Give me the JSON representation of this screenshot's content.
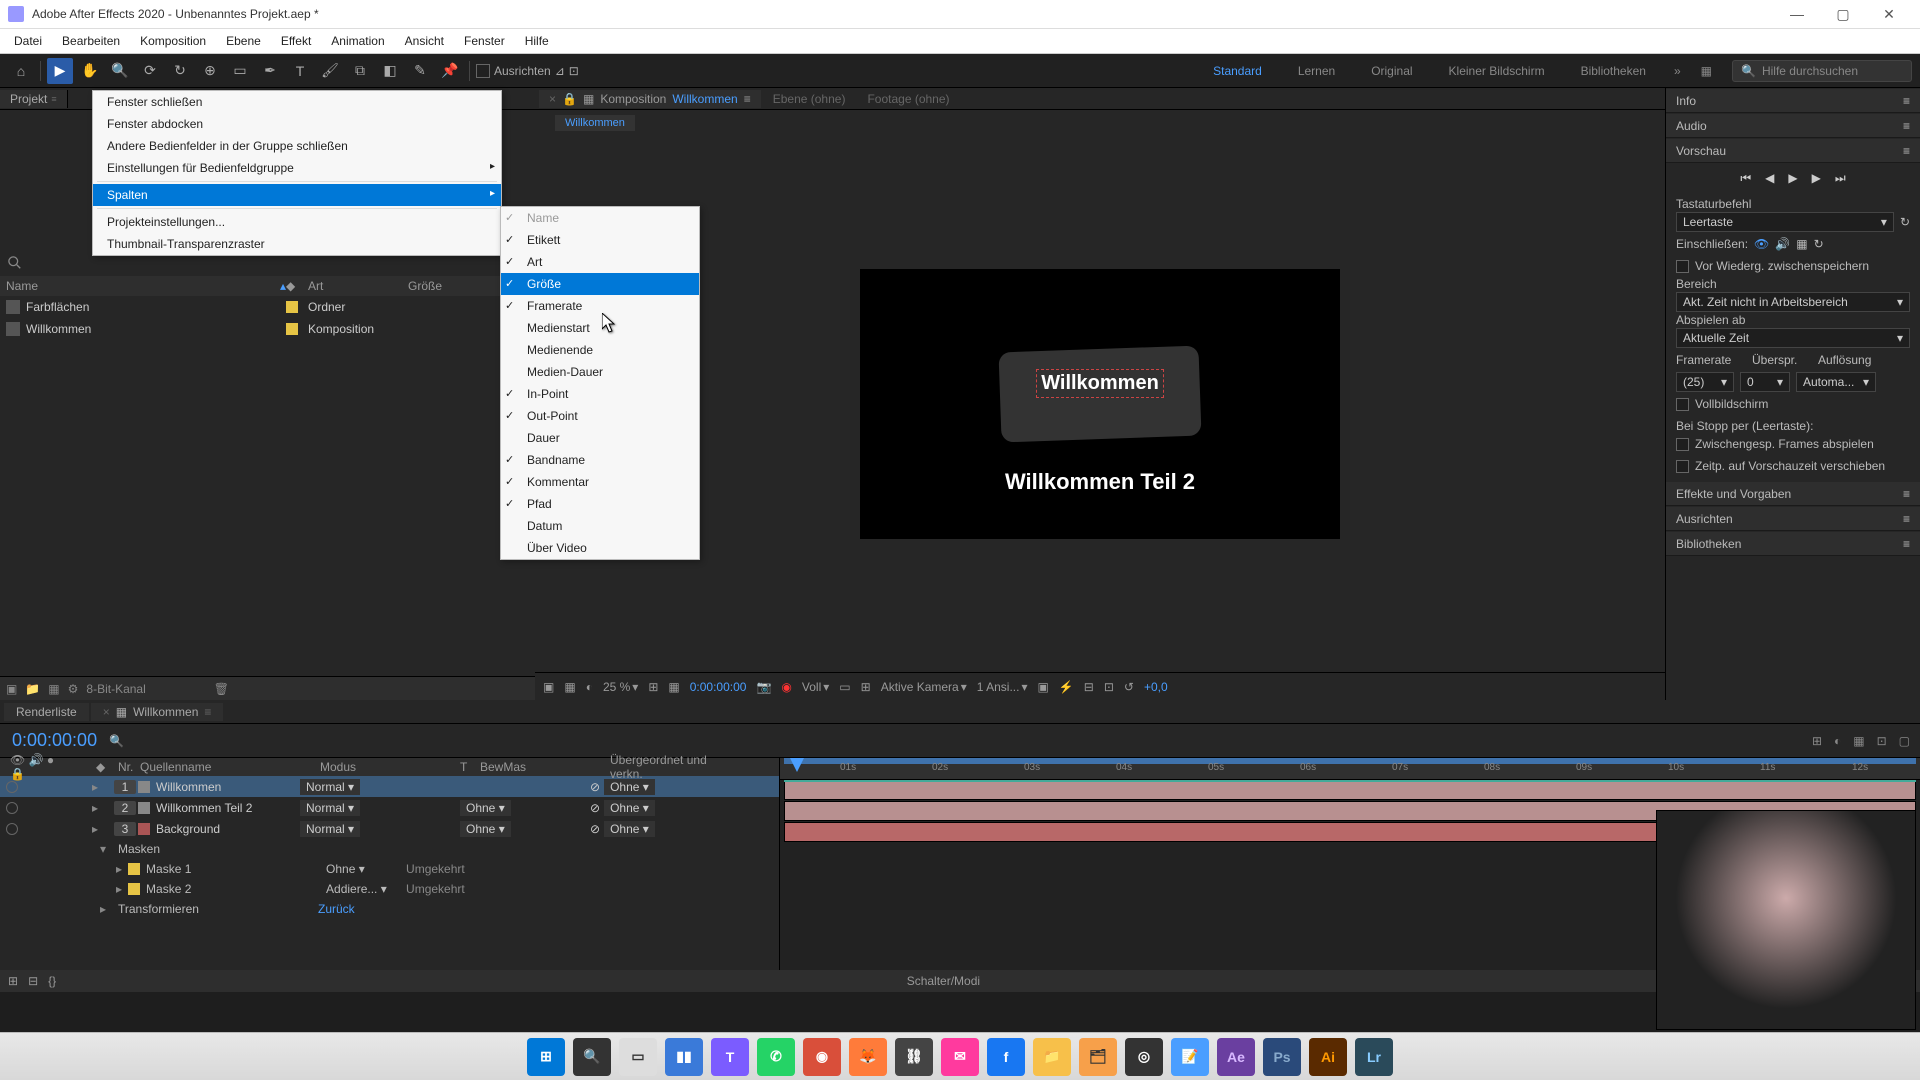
{
  "titlebar": {
    "title": "Adobe After Effects 2020 - Unbenanntes Projekt.aep *"
  },
  "menubar": [
    "Datei",
    "Bearbeiten",
    "Komposition",
    "Ebene",
    "Effekt",
    "Animation",
    "Ansicht",
    "Fenster",
    "Hilfe"
  ],
  "toolbar": {
    "snap_label": "Ausrichten",
    "workspaces": [
      "Standard",
      "Lernen",
      "Original",
      "Kleiner Bildschirm",
      "Bibliotheken"
    ],
    "active_ws": 0,
    "search_placeholder": "Hilfe durchsuchen"
  },
  "project": {
    "tab": "Projekt",
    "headers": {
      "name": "Name",
      "art": "Art",
      "groesse": "Größe"
    },
    "rows": [
      {
        "name": "Farbflächen",
        "swatch": "#e6c445",
        "art": "Ordner"
      },
      {
        "name": "Willkommen",
        "swatch": "#e6c445",
        "art": "Komposition"
      }
    ],
    "bit_label": "8-Bit-Kanal"
  },
  "panel_menu": {
    "items": [
      {
        "label": "Fenster schließen"
      },
      {
        "label": "Fenster abdocken"
      },
      {
        "label": "Andere Bedienfelder in der Gruppe schließen"
      },
      {
        "label": "Einstellungen für Bedienfeldgruppe",
        "sub": true
      },
      {
        "label": "Spalten",
        "sub": true,
        "hl": true
      },
      {
        "label": "Projekteinstellungen..."
      },
      {
        "label": "Thumbnail-Transparenzraster"
      }
    ]
  },
  "columns_menu": [
    {
      "label": "Name",
      "checked": true,
      "disabled": true
    },
    {
      "label": "Etikett",
      "checked": true
    },
    {
      "label": "Art",
      "checked": true
    },
    {
      "label": "Größe",
      "checked": true,
      "hl": true
    },
    {
      "label": "Framerate",
      "checked": true
    },
    {
      "label": "Medienstart"
    },
    {
      "label": "Medienende"
    },
    {
      "label": "Medien-Dauer"
    },
    {
      "label": "In-Point",
      "checked": true
    },
    {
      "label": "Out-Point",
      "checked": true
    },
    {
      "label": "Dauer"
    },
    {
      "label": "Bandname",
      "checked": true
    },
    {
      "label": "Kommentar",
      "checked": true
    },
    {
      "label": "Pfad",
      "checked": true
    },
    {
      "label": "Datum"
    },
    {
      "label": "Über Video"
    }
  ],
  "comp": {
    "tab_prefix": "Komposition",
    "tab_name": "Willkommen",
    "layer_tab": "Ebene  (ohne)",
    "footage_tab": "Footage  (ohne)",
    "breadcrumb": "Willkommen",
    "text1": "Willkommen",
    "text2": "Willkommen Teil 2"
  },
  "viewer": {
    "zoom": "25 %",
    "time": "0:00:00:00",
    "res": "Voll",
    "camera": "Aktive Kamera",
    "views": "1 Ansi...",
    "exposure": "+0,0"
  },
  "right_panels": {
    "info": "Info",
    "audio": "Audio",
    "preview": "Vorschau",
    "shortcut_lbl": "Tastaturbefehl",
    "shortcut_val": "Leertaste",
    "include_lbl": "Einschließen:",
    "cache_cb": "Vor Wiederg. zwischenspeichern",
    "range_lbl": "Bereich",
    "range_val": "Akt. Zeit nicht in Arbeitsbereich",
    "playfrom_lbl": "Abspielen ab",
    "playfrom_val": "Aktuelle Zeit",
    "fr_lbl": "Framerate",
    "skip_lbl": "Überspr.",
    "res_lbl": "Auflösung",
    "fr_val": "(25)",
    "skip_val": "0",
    "res_val": "Automa...",
    "fullscreen": "Vollbildschirm",
    "stop_lbl": "Bei Stopp per (Leertaste):",
    "stop_cb1": "Zwischengesp. Frames abspielen",
    "stop_cb2": "Zeitp. auf Vorschauzeit verschieben",
    "effects": "Effekte und Vorgaben",
    "align": "Ausrichten",
    "libraries": "Bibliotheken"
  },
  "timeline": {
    "render_tab": "Renderliste",
    "comp_tab": "Willkommen",
    "timecode": "0:00:00:00",
    "hdr": {
      "nr": "Nr.",
      "name": "Quellenname",
      "mode": "Modus",
      "t": "T",
      "trk": "BewMas",
      "parent": "Übergeordnet und verkn."
    },
    "layers": [
      {
        "num": "1",
        "name": "Willkommen",
        "swatch": "#d86666",
        "mode": "Normal",
        "trk": "",
        "parent": "Ohne",
        "type": "T",
        "sel": true
      },
      {
        "num": "2",
        "name": "Willkommen Teil 2",
        "swatch": "#d86666",
        "mode": "Normal",
        "trk": "Ohne",
        "parent": "Ohne",
        "type": "T"
      },
      {
        "num": "3",
        "name": "Background",
        "swatch": "#d86666",
        "mode": "Normal",
        "trk": "Ohne",
        "parent": "Ohne",
        "type": "S"
      }
    ],
    "masken": "Masken",
    "mask1": "Maske 1",
    "mask1_mode": "Ohne",
    "mask_inv": "Umgekehrt",
    "mask2": "Maske 2",
    "mask2_mode": "Addiere...",
    "transform": "Transformieren",
    "transform_reset": "Zurück",
    "ruler_ticks": [
      "01s",
      "02s",
      "03s",
      "04s",
      "05s",
      "06s",
      "07s",
      "08s",
      "09s",
      "10s",
      "11s",
      "12s"
    ],
    "footer": "Schalter/Modi"
  },
  "taskbar": [
    {
      "bg": "#0078d7",
      "fg": "#fff",
      "txt": "⊞"
    },
    {
      "bg": "#333",
      "fg": "#fff",
      "txt": "🔍"
    },
    {
      "bg": "#ddd",
      "fg": "#333",
      "txt": "▭"
    },
    {
      "bg": "#3a7ad9",
      "fg": "#fff",
      "txt": "▮▮"
    },
    {
      "bg": "#7b5cff",
      "fg": "#fff",
      "txt": "T"
    },
    {
      "bg": "#25d366",
      "fg": "#fff",
      "txt": "✆"
    },
    {
      "bg": "#d94f3a",
      "fg": "#fff",
      "txt": "◉"
    },
    {
      "bg": "#ff7b3a",
      "fg": "#fff",
      "txt": "🦊"
    },
    {
      "bg": "#444",
      "fg": "#fff",
      "txt": "⛓"
    },
    {
      "bg": "#ff3a9e",
      "fg": "#fff",
      "txt": "✉"
    },
    {
      "bg": "#1877f2",
      "fg": "#fff",
      "txt": "f"
    },
    {
      "bg": "#f7c04a",
      "fg": "#333",
      "txt": "📁"
    },
    {
      "bg": "#f7a04a",
      "fg": "#333",
      "txt": "🗂"
    },
    {
      "bg": "#333",
      "fg": "#fff",
      "txt": "◎"
    },
    {
      "bg": "#4a9eff",
      "fg": "#fff",
      "txt": "📝"
    },
    {
      "bg": "#6a3fa0",
      "fg": "#d8b8ff",
      "txt": "Ae"
    },
    {
      "bg": "#2a4a7a",
      "fg": "#8ac",
      "txt": "Ps"
    },
    {
      "bg": "#5a2a00",
      "fg": "#f90",
      "txt": "Ai"
    },
    {
      "bg": "#2a4a5a",
      "fg": "#8cf",
      "txt": "Lr"
    }
  ]
}
